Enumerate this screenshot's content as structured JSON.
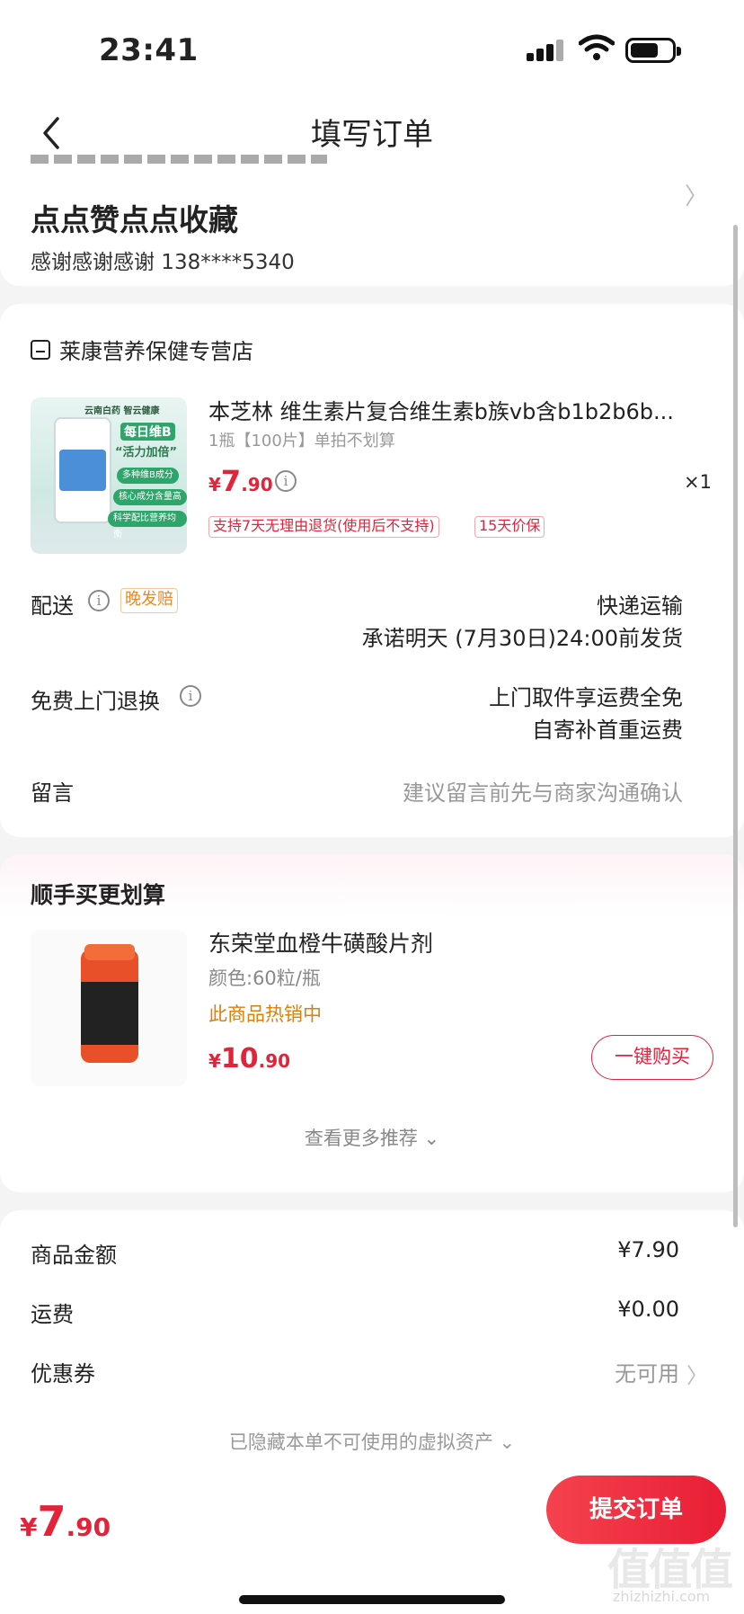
{
  "status": {
    "time": "23:41"
  },
  "nav": {
    "title": "填写订单"
  },
  "address": {
    "name": "点点赞点点收藏",
    "contact": "感谢感谢感谢  138****5340"
  },
  "shop": {
    "name": "莱康营养保健专营店",
    "product": {
      "title": "本芝林 维生素片复合维生素b族vb含b1b2b6b...",
      "sku": "1瓶【100片】单拍不划算",
      "price_yen": "¥",
      "price_int": "7",
      "price_dec": ".90",
      "qty": "×1",
      "badges": [
        "支持7天无理由退货(使用后不支持)",
        "15天价保"
      ],
      "image_text": {
        "brand": "云南白药 智云健康",
        "line1": "每日维B",
        "line2": "“活力加倍”",
        "line3": "多种维B成分",
        "line4": "核心成分含量高",
        "line5": "科学配比营养均衡"
      }
    },
    "delivery": {
      "label": "配送",
      "tag": "晚发赔",
      "value1": "快递运输",
      "value2": "承诺明天 (7月30日)24:00前发货"
    },
    "return": {
      "label": "免费上门退换",
      "value1": "上门取件享运费全免",
      "value2": "自寄补首重运费"
    },
    "message": {
      "label": "留言",
      "placeholder": "建议留言前先与商家沟通确认"
    }
  },
  "recommend": {
    "title": "顺手买更划算",
    "item": {
      "name": "东荣堂血橙牛磺酸片剂",
      "spec": "颜色:60粒/瓶",
      "hot": "此商品热销中",
      "price_yen": "¥",
      "price_int": "10",
      "price_dec": ".90",
      "buy": "一键购买"
    },
    "more": "查看更多推荐 ⌄"
  },
  "summary": {
    "rows": [
      {
        "label": "商品金额",
        "value": "¥7.90"
      },
      {
        "label": "运费",
        "value": "¥0.00"
      },
      {
        "label": "优惠券",
        "value": "无可用"
      }
    ],
    "hidden_note": "已隐藏本单不可使用的虚拟资产 ⌄"
  },
  "footer": {
    "total_yen": "¥",
    "total_int": "7",
    "total_dec": ".90",
    "submit": "提交订单"
  },
  "watermark": {
    "main": "值值值",
    "sub": "zhizhizhi.com"
  },
  "colors": {
    "accent": "#e2233a",
    "orange": "#d9800e",
    "bg": "#f4f4f4"
  }
}
